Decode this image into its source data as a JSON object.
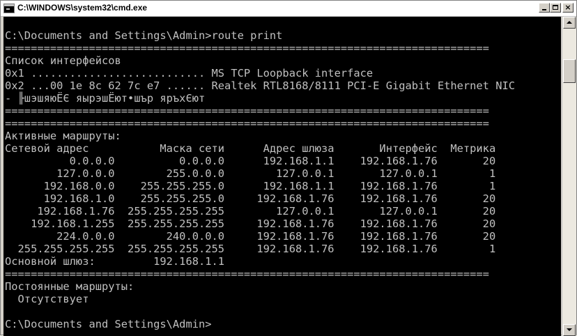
{
  "window": {
    "title": "C:\\WINDOWS\\system32\\cmd.exe",
    "icon": "cmd-icon",
    "buttons": {
      "minimize": "minimize-icon",
      "maximize": "maximize-icon",
      "close": "×"
    }
  },
  "colors": {
    "console_bg": "#000000",
    "console_fg": "#c0c0c0"
  },
  "console": {
    "lines": [
      "",
      "C:\\Documents and Settings\\Admin>route print",
      "===========================================================================",
      "Список интерфейсов",
      "0x1 ........................... MS TCP Loopback interface",
      "0x2 ...00 1e 8c 62 7c e7 ...... Realtek RTL8168/8111 PCI-E Gigabit Ethernet NIC",
      "- ╟шэшяюЁЄ яырэшЁют•шър яръхЄют",
      "===========================================================================",
      "===========================================================================",
      "Активные маршруты:",
      "Сетевой адрес           Маска сети      Адрес шлюза       Интерфейс  Метрика",
      "          0.0.0.0          0.0.0.0      192.168.1.1    192.168.1.76       20",
      "        127.0.0.0        255.0.0.0        127.0.0.1       127.0.0.1        1",
      "      192.168.0.0    255.255.255.0      192.168.1.1    192.168.1.76        1",
      "      192.168.1.0    255.255.255.0     192.168.1.76    192.168.1.76       20",
      "     192.168.1.76  255.255.255.255        127.0.0.1       127.0.0.1       20",
      "    192.168.1.255  255.255.255.255     192.168.1.76    192.168.1.76       20",
      "        224.0.0.0        240.0.0.0     192.168.1.76    192.168.1.76       20",
      "  255.255.255.255  255.255.255.255     192.168.1.76    192.168.1.76        1",
      "Основной шлюз:         192.168.1.1",
      "===========================================================================",
      "Постоянные маршруты:",
      "  Отсутствует",
      "",
      "C:\\Documents and Settings\\Admin>"
    ]
  }
}
